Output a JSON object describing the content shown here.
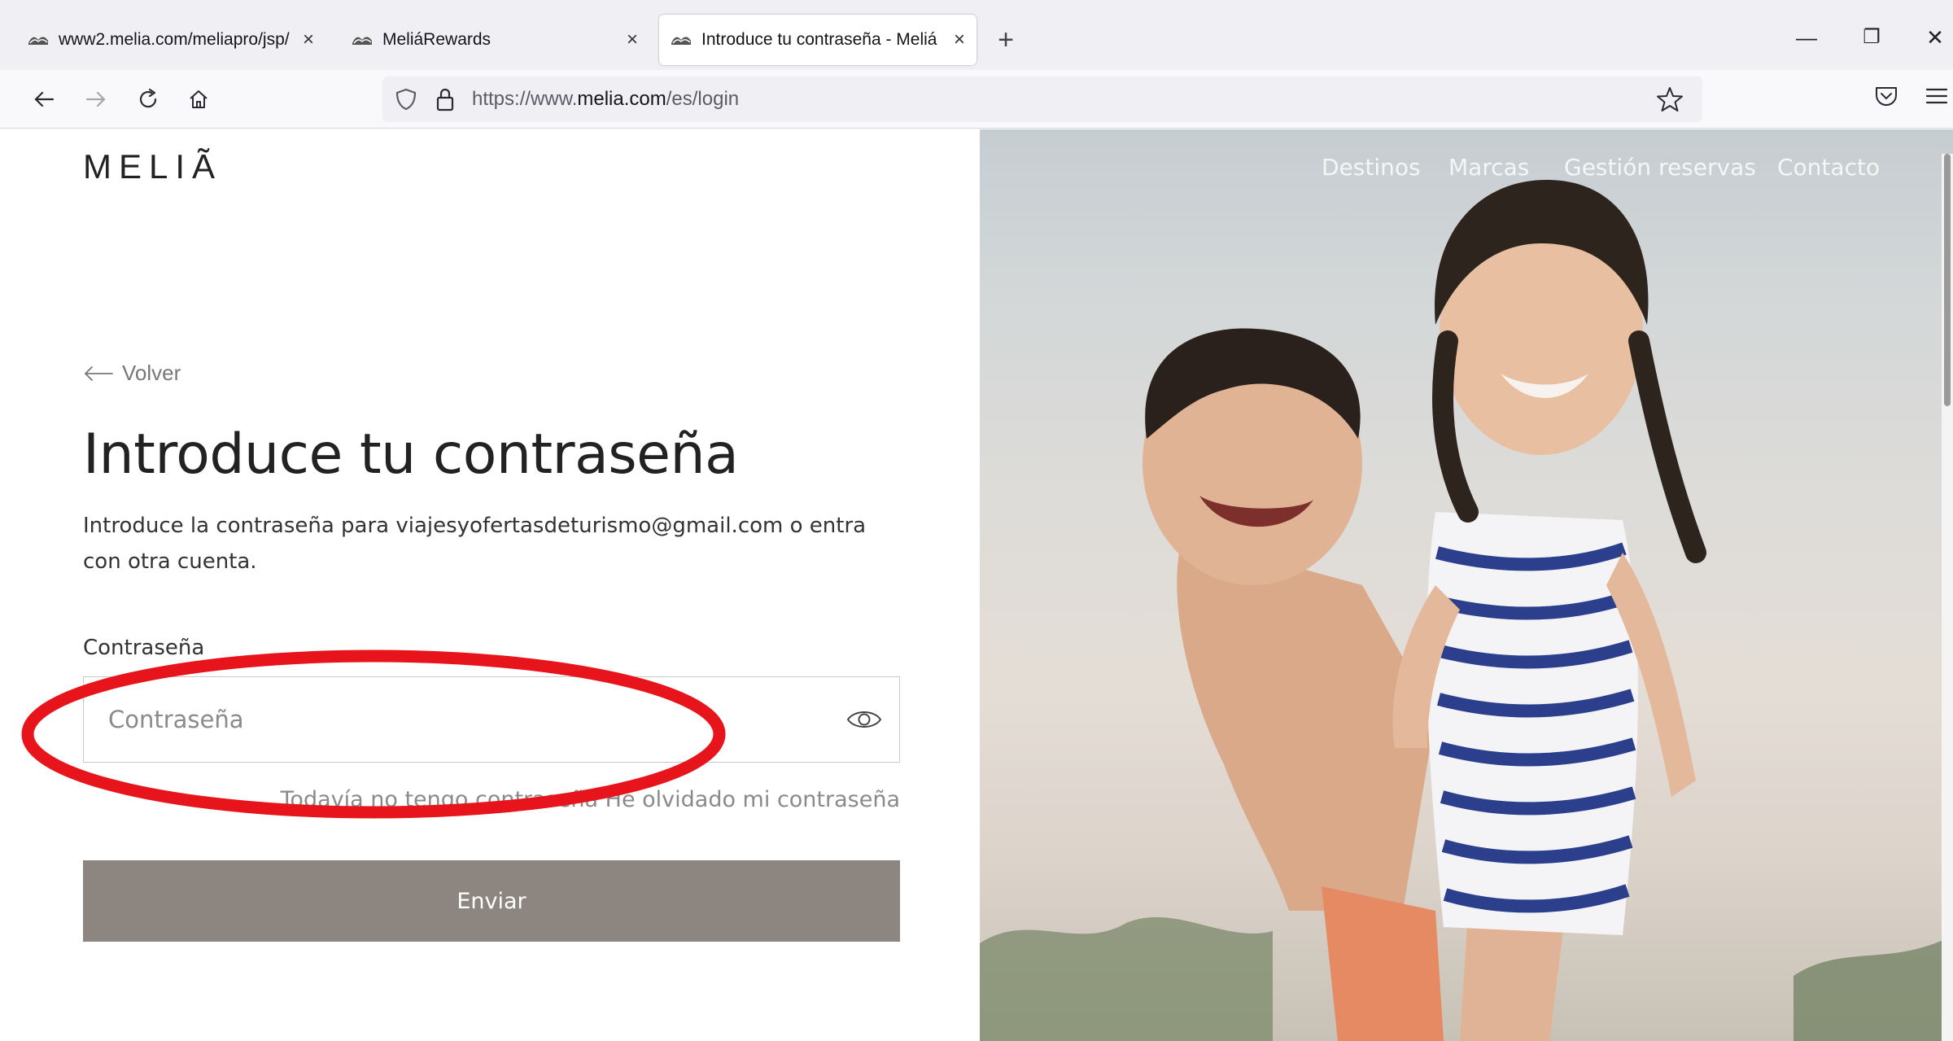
{
  "browser": {
    "tabs": [
      {
        "title": "www2.melia.com/meliapro/jsp/",
        "close": "×",
        "active": false
      },
      {
        "title": "MeliáRewards",
        "close": "×",
        "active": false
      },
      {
        "title": "Introduce tu contraseña - Meliá",
        "close": "×",
        "active": true
      }
    ],
    "new_tab": "+",
    "window_controls": {
      "minimize": "—",
      "restore": "❐",
      "close": "✕"
    },
    "url": {
      "prefix": "https://www.",
      "host": "melia.com",
      "path": "/es/login"
    }
  },
  "site": {
    "logo": "MELIÃ",
    "top_nav": [
      "Destinos",
      "Marcas",
      "Gestión reservas",
      "Contacto"
    ]
  },
  "login": {
    "back_label": "Volver",
    "heading": "Introduce tu contraseña",
    "description": "Introduce la contraseña para viajesyofertasdeturismo@gmail.com o entra con otra cuenta.",
    "field_label": "Contraseña",
    "password_placeholder": "Contraseña",
    "password_value": "",
    "no_password_link": "Todavía no tengo contraseña",
    "forgot_password_link": "He olvidado mi contraseña",
    "submit_label": "Enviar"
  },
  "colors": {
    "submit_bg": "#8d8580",
    "annotation": "#e8141b",
    "tab_bar_bg": "#f0f0f4"
  },
  "icons": [
    "melia-favicon",
    "back-arrow-icon",
    "forward-arrow-icon",
    "reload-icon",
    "home-icon",
    "shield-icon",
    "lock-icon",
    "star-icon",
    "pocket-icon",
    "menu-icon",
    "eye-icon",
    "arrow-left-icon"
  ]
}
